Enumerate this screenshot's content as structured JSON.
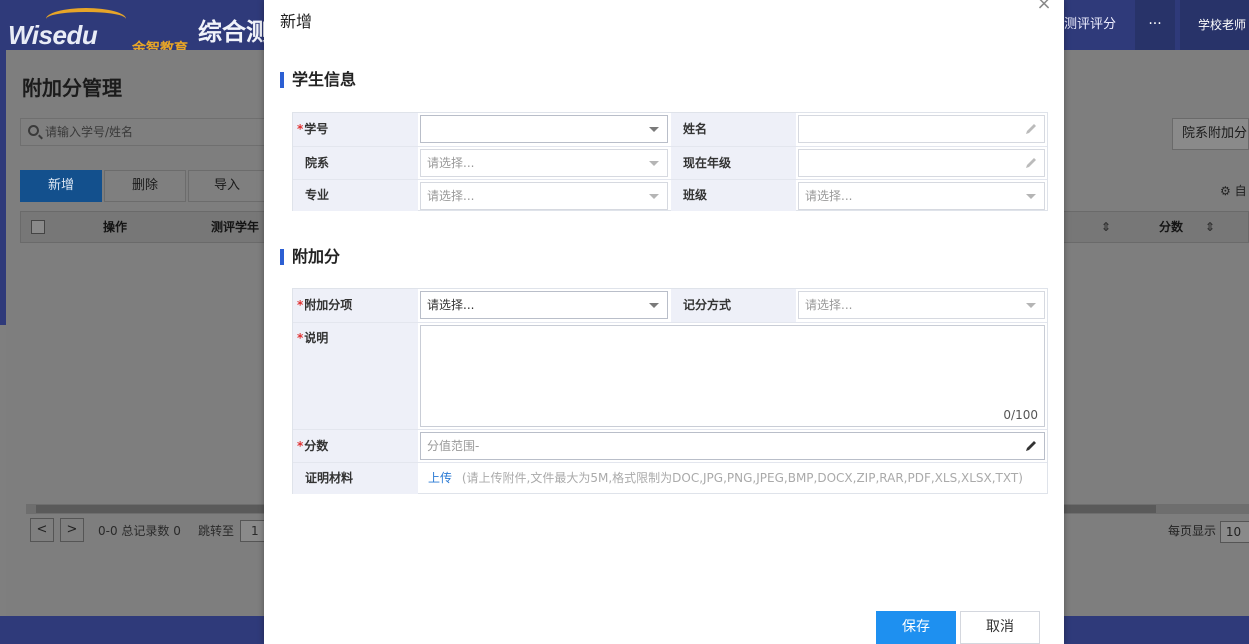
{
  "header": {
    "logo_text": "Wisedu",
    "logo_subtext": "金智教育",
    "app_title": "综合测",
    "nav_item": "测评评分",
    "more": "···",
    "user": "学校老师"
  },
  "page": {
    "title": "附加分管理",
    "search_placeholder": "请输入学号/姓名",
    "buttons": {
      "add": "新增",
      "delete": "删除",
      "import": "导入"
    },
    "right_tag": "院系附加分",
    "table_headers": {
      "action": "操作",
      "year": "测评学年",
      "score": "分数"
    },
    "pager": {
      "range": "0-0 总记录数 0",
      "jump": "跳转至",
      "jump_value": "1",
      "per_page": "每页显示",
      "per_page_value": "10"
    },
    "col_icon": "⚙ 自"
  },
  "modal": {
    "title": "新增",
    "close": "×",
    "student_section": "学生信息",
    "score_section": "附加分",
    "fields": {
      "student_id": {
        "label": "学号",
        "value": ""
      },
      "name": {
        "label": "姓名",
        "value": ""
      },
      "department": {
        "label": "院系",
        "placeholder": "请选择..."
      },
      "grade": {
        "label": "现在年级",
        "value": ""
      },
      "major": {
        "label": "专业",
        "placeholder": "请选择..."
      },
      "class": {
        "label": "班级",
        "placeholder": "请选择..."
      },
      "item": {
        "label": "附加分项",
        "placeholder": "请选择..."
      },
      "method": {
        "label": "记分方式",
        "placeholder": "请选择..."
      },
      "desc": {
        "label": "说明",
        "counter": "0/100"
      },
      "score": {
        "label": "分数",
        "placeholder": "分值范围-"
      },
      "proof": {
        "label": "证明材料",
        "upload": "上传",
        "hint": "(请上传附件,文件最大为5M,格式限制为DOC,JPG,PNG,JPEG,BMP,DOCX,ZIP,RAR,PDF,XLS,XLSX,TXT)"
      }
    },
    "save": "保存",
    "cancel": "取消"
  }
}
